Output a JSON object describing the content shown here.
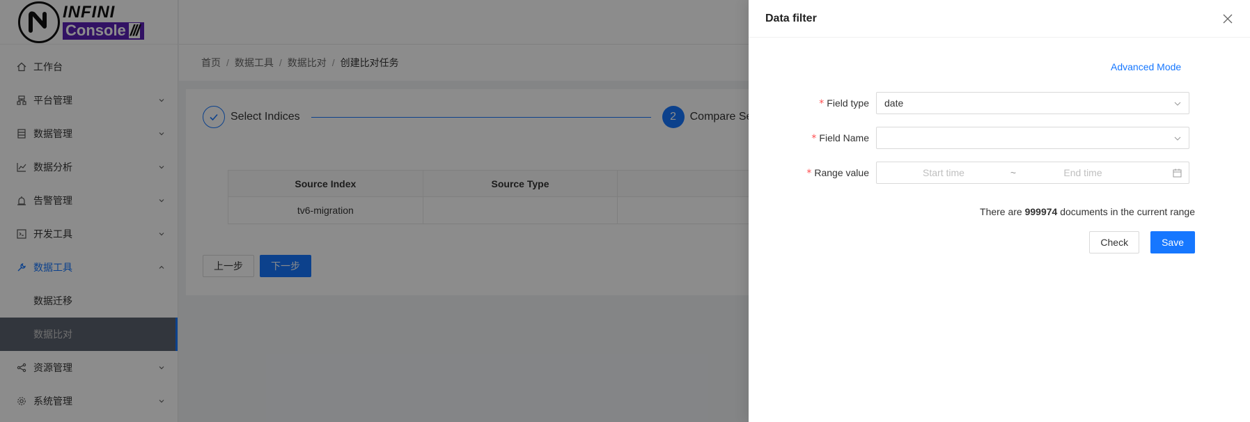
{
  "logo": {
    "top": "INFINI",
    "bottom": "Console",
    "slashes": "///"
  },
  "sidebar": {
    "items": [
      {
        "label": "工作台",
        "icon": "home-icon",
        "arrow": false
      },
      {
        "label": "平台管理",
        "icon": "cluster-icon",
        "arrow": true
      },
      {
        "label": "数据管理",
        "icon": "database-icon",
        "arrow": true
      },
      {
        "label": "数据分析",
        "icon": "chart-icon",
        "arrow": true
      },
      {
        "label": "告警管理",
        "icon": "alarm-icon",
        "arrow": true
      },
      {
        "label": "开发工具",
        "icon": "code-icon",
        "arrow": true
      },
      {
        "label": "数据工具",
        "icon": "tool-icon",
        "arrow": true,
        "active": true
      },
      {
        "label": "资源管理",
        "icon": "share-icon",
        "arrow": true
      },
      {
        "label": "系统管理",
        "icon": "gear-icon",
        "arrow": true
      }
    ],
    "sub_items": [
      "数据迁移",
      "数据比对"
    ]
  },
  "breadcrumb": [
    "首页",
    "数据工具",
    "数据比对",
    "创建比对任务"
  ],
  "steps": [
    {
      "num": "1",
      "title": "Select Indices"
    },
    {
      "num": "2",
      "title": "Compare Se"
    }
  ],
  "table": {
    "headers": [
      "Source Index",
      "Source Type",
      ""
    ],
    "rows": [
      [
        "tv6-migration",
        "",
        ""
      ]
    ]
  },
  "buttons": {
    "prev": "上一步",
    "next": "下一步"
  },
  "drawer": {
    "title": "Data filter",
    "advanced_mode": "Advanced Mode",
    "field_type_label": "Field type",
    "field_type_value": "date",
    "field_name_label": "Field Name",
    "field_name_value": "",
    "range_label": "Range value",
    "start_placeholder": "Start time",
    "range_sep": "~",
    "end_placeholder": "End time",
    "doc_prefix": "There are",
    "doc_count": "999974",
    "doc_suffix": "documents in the current range",
    "check": "Check",
    "save": "Save"
  },
  "colors": {
    "primary": "#1677ff",
    "required": "#ff4d4f",
    "brand": "#5b21b6"
  }
}
